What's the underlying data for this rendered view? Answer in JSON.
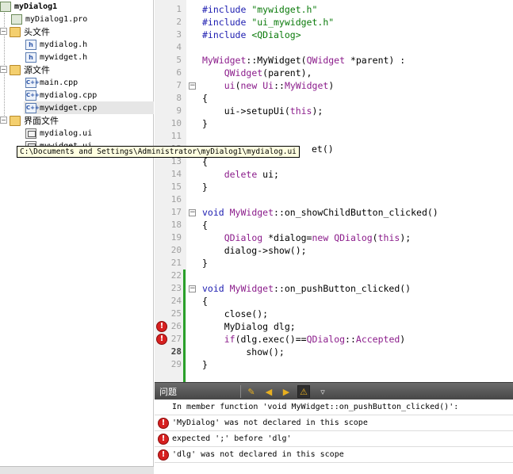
{
  "tree": {
    "project": "myDialog1",
    "items": [
      {
        "label": "myDialog1.pro"
      },
      {
        "label": "头文件"
      },
      {
        "label": "mydialog.h"
      },
      {
        "label": "mywidget.h"
      },
      {
        "label": "源文件"
      },
      {
        "label": "main.cpp"
      },
      {
        "label": "mydialog.cpp"
      },
      {
        "label": "mywidget.cpp"
      },
      {
        "label": "界面文件"
      },
      {
        "label": "mydialog.ui"
      },
      {
        "label": "mywidget.ui"
      }
    ]
  },
  "tooltip": "C:\\Documents and Settings\\Administrator\\myDialog1\\mydialog.ui",
  "editor": {
    "current_line": 28,
    "lines": [
      {
        "n": "1"
      },
      {
        "n": "2"
      },
      {
        "n": "3"
      },
      {
        "n": "4"
      },
      {
        "n": "5"
      },
      {
        "n": "6"
      },
      {
        "n": "7"
      },
      {
        "n": "8"
      },
      {
        "n": "9"
      },
      {
        "n": "10"
      },
      {
        "n": "11"
      },
      {
        "n": "12"
      },
      {
        "n": "13"
      },
      {
        "n": "14"
      },
      {
        "n": "15"
      },
      {
        "n": "16"
      },
      {
        "n": "17"
      },
      {
        "n": "18"
      },
      {
        "n": "19"
      },
      {
        "n": "20"
      },
      {
        "n": "21"
      },
      {
        "n": "22"
      },
      {
        "n": "23"
      },
      {
        "n": "24"
      },
      {
        "n": "25"
      },
      {
        "n": "26"
      },
      {
        "n": "27"
      },
      {
        "n": "28"
      },
      {
        "n": "29"
      }
    ],
    "code": {
      "l1a": "#include ",
      "l1b": "\"mywidget.h\"",
      "l2a": "#include ",
      "l2b": "\"ui_mywidget.h\"",
      "l3a": "#include ",
      "l3b": "<QDialog>",
      "l5a": "MyWidget",
      "l5b": "::MyWidget(",
      "l5c": "QWidget",
      "l5d": " *parent) :",
      "l6a": "    ",
      "l6b": "QWidget",
      "l6c": "(parent),",
      "l7a": "    ",
      "l7b": "ui",
      "l7c": "(",
      "l7d": "new",
      "l7e": " ",
      "l7f": "Ui",
      "l7g": "::",
      "l7h": "MyWidget",
      "l7i": ")",
      "l8": "{",
      "l9a": "    ui->setupUi(",
      "l9b": "this",
      "l9c": ");",
      "l10": "}",
      "l12": "et()",
      "l13": "{",
      "l14a": "    ",
      "l14b": "delete",
      "l14c": " ui;",
      "l15": "}",
      "l17a": "void ",
      "l17b": "MyWidget",
      "l17c": "::on_showChildButton_clicked()",
      "l18": "{",
      "l19a": "    ",
      "l19b": "QDialog",
      "l19c": " *dialog=",
      "l19d": "new",
      "l19e": " ",
      "l19f": "QDialog",
      "l19g": "(",
      "l19h": "this",
      "l19i": ");",
      "l20": "    dialog->show();",
      "l21": "}",
      "l23a": "void ",
      "l23b": "MyWidget",
      "l23c": "::on_pushButton_clicked()",
      "l24": "{",
      "l25": "    close();",
      "l26": "    MyDialog dlg;",
      "l27a": "    ",
      "l27b": "if",
      "l27c": "(dlg.exec()==",
      "l27d": "QDialog",
      "l27e": "::",
      "l27f": "Accepted",
      "l27g": ")",
      "l28": "        show();",
      "l29": "}"
    }
  },
  "issues": {
    "title": "问题",
    "rows": [
      {
        "text": "In member function 'void MyWidget::on_pushButton_clicked()':"
      },
      {
        "text": "'MyDialog' was not declared in this scope"
      },
      {
        "text": "expected ';' before 'dlg'"
      },
      {
        "text": "'dlg' was not declared in this scope"
      }
    ]
  },
  "colors": {
    "preprocessor": "#1c1cb0",
    "string": "#0a7a0a",
    "type": "#8b1c8b",
    "error": "#d72020",
    "change_bar": "#2aa02a"
  }
}
